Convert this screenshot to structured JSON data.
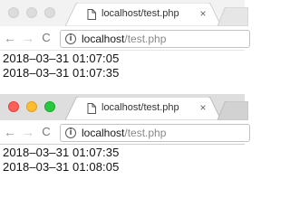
{
  "windows": [
    {
      "tab": {
        "title": "localhost/test.php",
        "close": "×"
      },
      "omnibox": {
        "host": "localhost",
        "path": "/test.php"
      },
      "lines": [
        "2018–03–31 01:07:05",
        "2018–03–31 01:07:35"
      ],
      "focused": false
    },
    {
      "tab": {
        "title": "localhost/test.php",
        "close": "×"
      },
      "omnibox": {
        "host": "localhost",
        "path": "/test.php"
      },
      "lines": [
        "2018–03–31 01:07:35",
        "2018–03–31 01:08:05"
      ],
      "focused": true
    }
  ],
  "colors": {
    "traffic_red": "#fe5f57",
    "traffic_yellow": "#febc2e",
    "traffic_green": "#28c840",
    "url_path_grey": "#888888"
  },
  "icons": {
    "back": "arrow-left-icon",
    "forward": "arrow-right-icon",
    "reload": "reload-icon",
    "info": "info-icon",
    "page": "page-icon"
  }
}
